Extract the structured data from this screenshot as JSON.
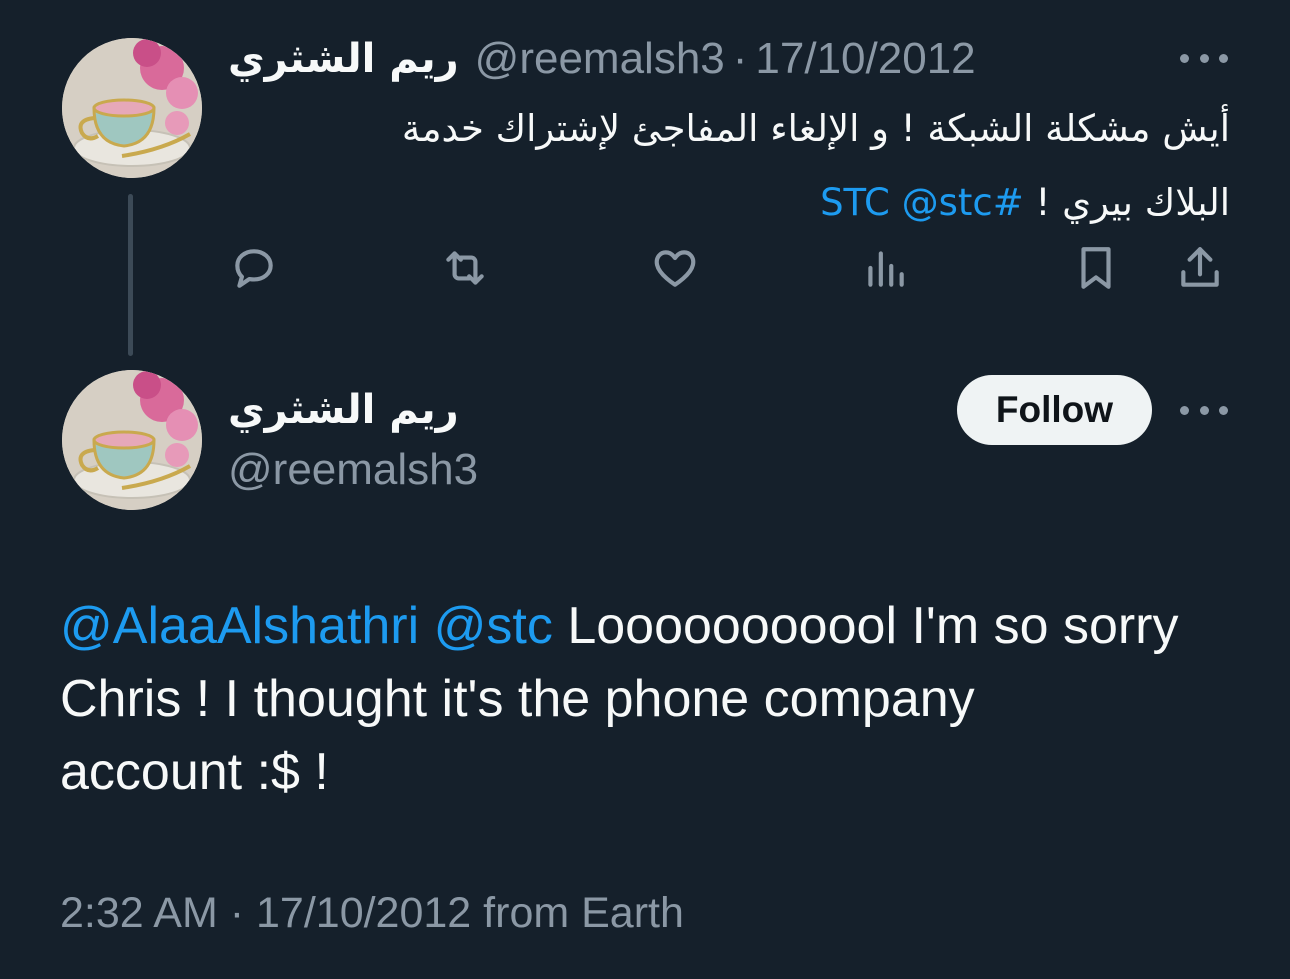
{
  "parent_tweet": {
    "display_name": "ريم الشثري",
    "handle": "@reemalsh3",
    "separator": "·",
    "date": "17/10/2012",
    "text_line1": "أيش مشكلة الشبكة ! و الإلغاء المفاجئ لإشتراك خدمة",
    "text_line2_plain": "البلاك بيري ! ",
    "hashtag": "#STC",
    "mention": "@stc",
    "icons": [
      "more-icon",
      "reply-icon",
      "retweet-icon",
      "like-icon",
      "views-icon",
      "bookmark-icon",
      "share-icon"
    ]
  },
  "main_tweet": {
    "display_name": "ريم الشثري",
    "handle": "@reemalsh3",
    "follow_label": "Follow",
    "mention_1": "@AlaaAlshathri",
    "mention_2": "@stc",
    "text_line1": " Looooooooool I'm so sorry",
    "text_line2": "Chris ! I thought it's the phone company",
    "text_line3": "account :$ !",
    "timestamp": "2:32 AM",
    "separator": "·",
    "date": "17/10/2012",
    "source": "from Earth"
  },
  "colors": {
    "background": "#15202b",
    "text_primary": "#f7f9f9",
    "text_secondary": "#8b98a5",
    "link": "#1d9bf0",
    "follow_button_bg": "#eff3f4"
  }
}
